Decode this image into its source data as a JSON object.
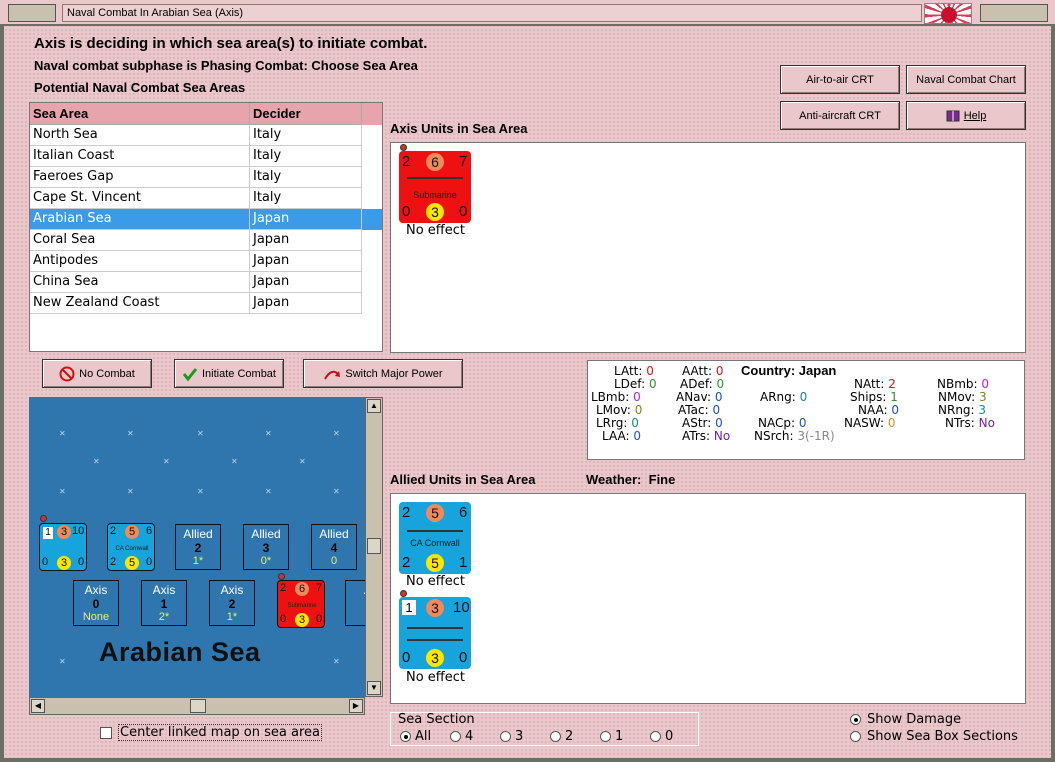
{
  "window": {
    "title": "Naval Combat In Arabian Sea (Axis)"
  },
  "header": {
    "line1": "Axis is deciding in which sea area(s) to initiate combat.",
    "line2": "Naval combat subphase is Phasing Combat: Choose Sea Area",
    "line3": "Potential Naval Combat Sea Areas"
  },
  "charts_buttons": {
    "air_to_air": "Air-to-air CRT",
    "naval_combat": "Naval Combat Chart",
    "anti_aircraft": "Anti-aircraft CRT",
    "help": "Help"
  },
  "sea_table": {
    "headers": [
      "Sea Area",
      "Decider"
    ],
    "rows": [
      {
        "area": "North Sea",
        "decider": "Italy"
      },
      {
        "area": "Italian Coast",
        "decider": "Italy"
      },
      {
        "area": "Faeroes Gap",
        "decider": "Italy"
      },
      {
        "area": "Cape St. Vincent",
        "decider": "Italy"
      },
      {
        "area": "Arabian Sea",
        "decider": "Japan",
        "selected": true
      },
      {
        "area": "Coral Sea",
        "decider": "Japan"
      },
      {
        "area": "Antipodes",
        "decider": "Japan"
      },
      {
        "area": "China Sea",
        "decider": "Japan"
      },
      {
        "area": "New Zealand Coast",
        "decider": "Japan"
      }
    ]
  },
  "actions": {
    "no_combat": "No Combat",
    "initiate": "Initiate Combat",
    "switch": "Switch Major Power"
  },
  "axis_units": {
    "label": "Axis Units in Sea Area",
    "unit": {
      "tl": "2",
      "tm": "6",
      "tr": "7",
      "name": "Submarine",
      "bl": "0",
      "bm": "3",
      "br": "0",
      "effect": "No effect"
    }
  },
  "stats": {
    "country_label": "Country:",
    "country": "Japan",
    "items": [
      {
        "k": "LAtt:",
        "v": "0",
        "c": "v-red"
      },
      {
        "k": "LDef:",
        "v": "0",
        "c": "v-grn"
      },
      {
        "k": "LBmb:",
        "v": "0",
        "c": "v-mag"
      },
      {
        "k": "LMov:",
        "v": "0",
        "c": "v-olv"
      },
      {
        "k": "LRrg:",
        "v": "0",
        "c": "v-tea"
      },
      {
        "k": "LAA:",
        "v": "0",
        "c": "v-blu"
      },
      {
        "k": "AAtt:",
        "v": "0",
        "c": "v-red"
      },
      {
        "k": "ADef:",
        "v": "0",
        "c": "v-grn"
      },
      {
        "k": "ANav:",
        "v": "0",
        "c": "v-blu"
      },
      {
        "k": "ATac:",
        "v": "0",
        "c": "v-blu"
      },
      {
        "k": "AStr:",
        "v": "0",
        "c": "v-blu"
      },
      {
        "k": "ATrs:",
        "v": "No",
        "c": "v-pur"
      },
      {
        "k": "ARng:",
        "v": "0",
        "c": "v-tea"
      },
      {
        "k": "NACp:",
        "v": "0",
        "c": "v-blu"
      },
      {
        "k": "NSrch:",
        "v": "3(-1R)",
        "c": "v-gry"
      },
      {
        "k": "NAtt:",
        "v": "2",
        "c": "v-red"
      },
      {
        "k": "Ships:",
        "v": "1",
        "c": "v-grn"
      },
      {
        "k": "NAA:",
        "v": "0",
        "c": "v-blu"
      },
      {
        "k": "NASW:",
        "v": "0",
        "c": "v-org"
      },
      {
        "k": "NBmb:",
        "v": "0",
        "c": "v-mag"
      },
      {
        "k": "NMov:",
        "v": "3",
        "c": "v-olv"
      },
      {
        "k": "NRng:",
        "v": "3",
        "c": "v-tea"
      },
      {
        "k": "NTrs:",
        "v": "No",
        "c": "v-pur"
      }
    ]
  },
  "allied_units": {
    "label": "Allied Units in Sea Area",
    "weather_label": "Weather:",
    "weather": "Fine",
    "units": [
      {
        "tl": "2",
        "tm": "5",
        "tr": "6",
        "name": "CA Cornwall",
        "bl": "2",
        "bm": "5",
        "br": "1",
        "effect": "No effect"
      },
      {
        "tl": "1",
        "tm": "3",
        "tr": "10",
        "name": "",
        "bl": "0",
        "bm": "3",
        "br": "0",
        "effect": "No effect"
      }
    ]
  },
  "map": {
    "sea_name": "Arabian Sea",
    "allied_boxes": [
      {
        "t": "Allied",
        "n": "2",
        "s": "1*"
      },
      {
        "t": "Allied",
        "n": "3",
        "s": "0*"
      },
      {
        "t": "Allied",
        "n": "4",
        "s": "0"
      }
    ],
    "axis_boxes": [
      {
        "t": "Axis",
        "n": "0",
        "s": "None"
      },
      {
        "t": "Axis",
        "n": "1",
        "s": "2*"
      },
      {
        "t": "Axis",
        "n": "2",
        "s": "1*"
      },
      {
        "t": "A"
      }
    ],
    "map_counters": {
      "a": {
        "tl": "1",
        "tm": "3",
        "tr": "10",
        "bl": "0",
        "bm": "3",
        "br": "0"
      },
      "b": {
        "tl": "2",
        "tm": "5",
        "tr": "6",
        "name": "CA Cornwall",
        "bl": "2",
        "bm": "5",
        "br": "0"
      },
      "c": {
        "tl": "2",
        "tm": "6",
        "tr": "7",
        "name": "Submarine",
        "bl": "0",
        "bm": "3",
        "br": "0"
      }
    }
  },
  "center_map": "Center linked map on sea area",
  "sea_section": {
    "label": "Sea Section",
    "options": [
      "All",
      "4",
      "3",
      "2",
      "1",
      "0"
    ],
    "selected": "All"
  },
  "display_opts": {
    "show_damage": "Show Damage",
    "show_box": "Show Sea Box Sections",
    "selected": "show_damage"
  }
}
